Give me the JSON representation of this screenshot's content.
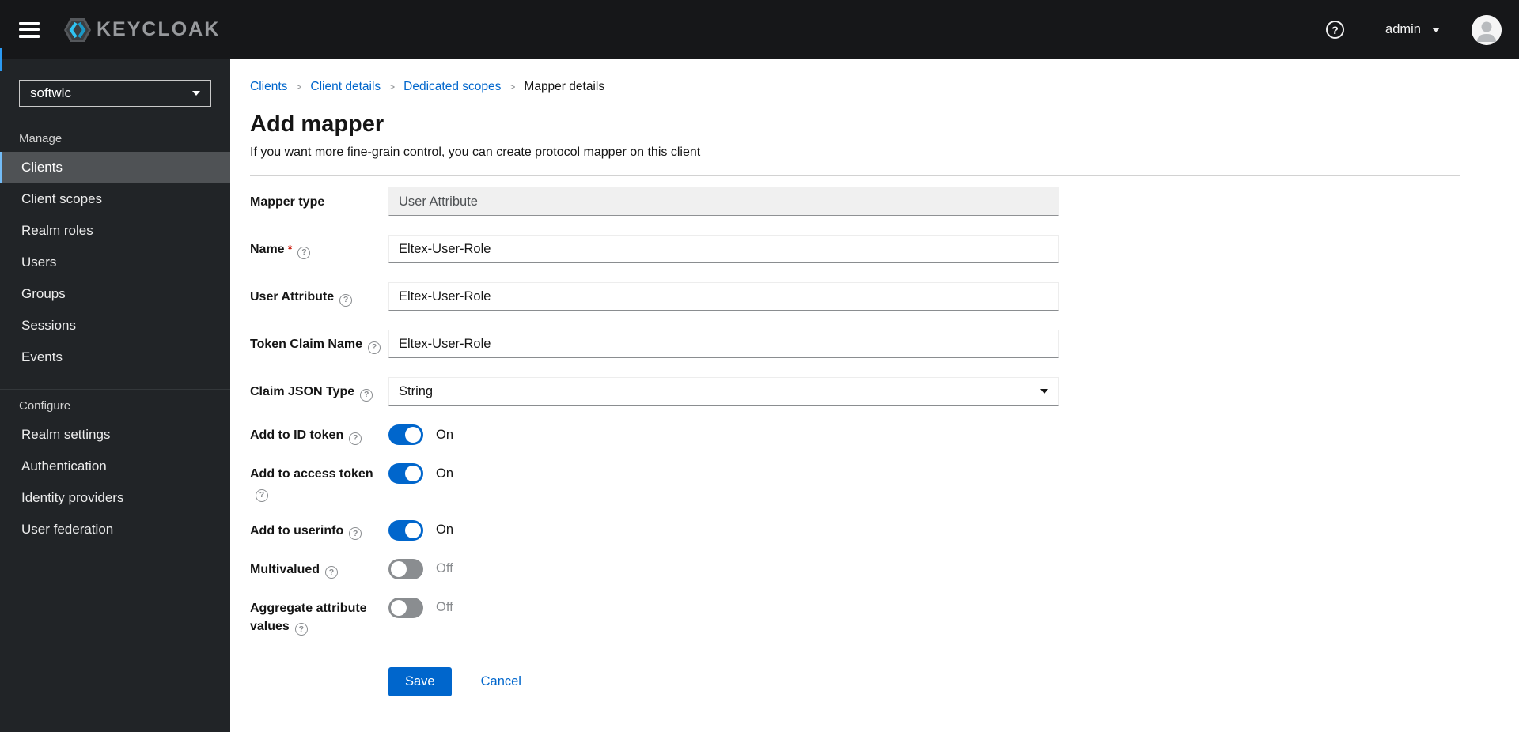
{
  "masthead": {
    "brand": "KEYCLOAK",
    "username": "admin"
  },
  "sidebar": {
    "realm": "softwlc",
    "groups": [
      {
        "label": "Manage",
        "items": [
          {
            "label": "Clients",
            "active": true
          },
          {
            "label": "Client scopes",
            "active": false
          },
          {
            "label": "Realm roles",
            "active": false
          },
          {
            "label": "Users",
            "active": false
          },
          {
            "label": "Groups",
            "active": false
          },
          {
            "label": "Sessions",
            "active": false
          },
          {
            "label": "Events",
            "active": false
          }
        ]
      },
      {
        "label": "Configure",
        "items": [
          {
            "label": "Realm settings",
            "active": false
          },
          {
            "label": "Authentication",
            "active": false
          },
          {
            "label": "Identity providers",
            "active": false
          },
          {
            "label": "User federation",
            "active": false
          }
        ]
      }
    ]
  },
  "breadcrumb": {
    "items": [
      {
        "label": "Clients",
        "link": true
      },
      {
        "label": "Client details",
        "link": true
      },
      {
        "label": "Dedicated scopes",
        "link": true
      },
      {
        "label": "Mapper details",
        "link": false
      }
    ]
  },
  "page": {
    "title": "Add mapper",
    "subtitle": "If you want more fine-grain control, you can create protocol mapper on this client"
  },
  "form": {
    "fields": [
      {
        "label": "Mapper type",
        "value": "User Attribute",
        "disabled": true,
        "required": false,
        "help": false
      },
      {
        "label": "Name",
        "value": "Eltex-User-Role",
        "disabled": false,
        "required": true,
        "help": true
      },
      {
        "label": "User Attribute",
        "value": "Eltex-User-Role",
        "disabled": false,
        "required": false,
        "help": true
      },
      {
        "label": "Token Claim Name",
        "value": "Eltex-User-Role",
        "disabled": false,
        "required": false,
        "help": true
      },
      {
        "label": "Claim JSON Type",
        "value": "String",
        "type": "select",
        "required": false,
        "help": true
      }
    ],
    "switches": [
      {
        "label": "Add to ID token",
        "on": true,
        "state_label": "On"
      },
      {
        "label": "Add to access token",
        "on": true,
        "state_label": "On"
      },
      {
        "label": "Add to userinfo",
        "on": true,
        "state_label": "On"
      },
      {
        "label": "Multivalued",
        "on": false,
        "state_label": "Off"
      },
      {
        "label": "Aggregate attribute values",
        "on": false,
        "state_label": "Off"
      }
    ],
    "actions": {
      "save": "Save",
      "cancel": "Cancel"
    }
  },
  "icons": [
    "hamburger-icon",
    "keycloak-logo-icon",
    "help-icon",
    "chevron-down-icon",
    "avatar-icon",
    "question-circle-icon",
    "select-caret-icon"
  ],
  "colors": {
    "masthead_bg": "#161719",
    "sidebar_bg": "#212427",
    "nav_active_bg": "#4f5255",
    "nav_active_border": "#73bcf7",
    "accent_blue": "#0066cc",
    "toggle_off": "#8a8d90",
    "required_red": "#c9190b",
    "disabled_bg": "#f0f0f0",
    "divider": "#d2d2d2",
    "left_accent": "#2b9af3"
  }
}
